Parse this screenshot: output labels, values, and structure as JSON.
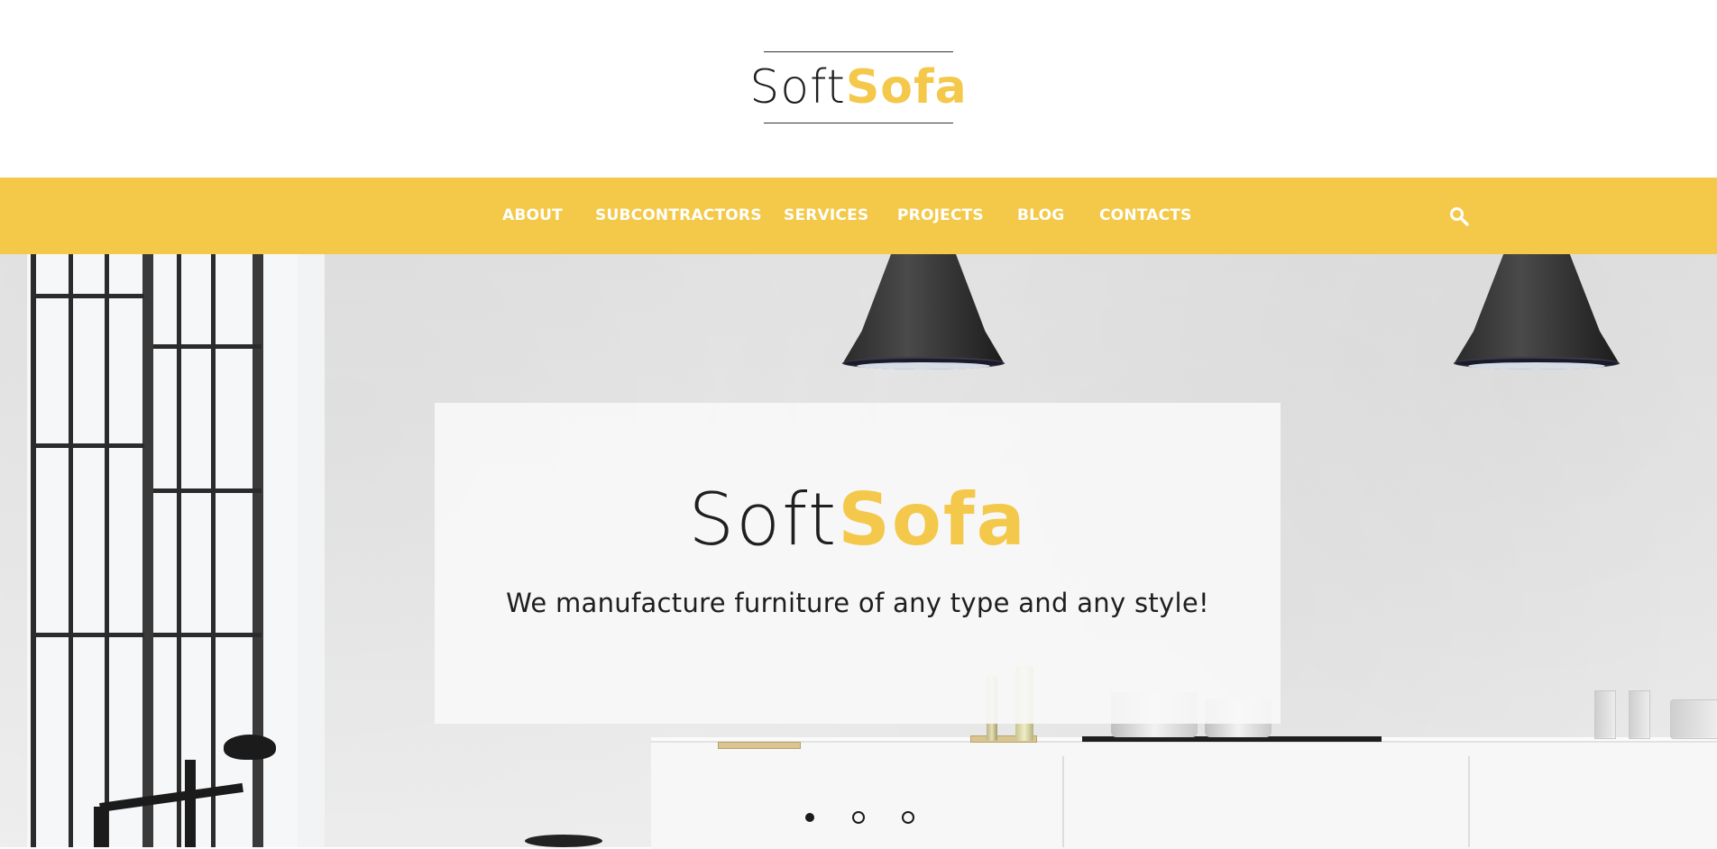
{
  "header": {
    "logo": {
      "part1": "Soft",
      "part2": "Sofa"
    }
  },
  "nav": {
    "items": [
      {
        "label": "ABOUT"
      },
      {
        "label": "SUBCONTRACTORS"
      },
      {
        "label": "SERVICES"
      },
      {
        "label": "PROJECTS"
      },
      {
        "label": "BLOG"
      },
      {
        "label": "CONTACTS"
      }
    ],
    "search_icon": "search-icon"
  },
  "hero": {
    "title_part1": "Soft",
    "title_part2": "Sofa",
    "subtitle": "We manufacture furniture of any type and any style!",
    "slides": {
      "count": 3,
      "active_index": 0
    }
  },
  "colors": {
    "accent": "#f4c94a",
    "text_dark": "#1f1f1f",
    "nav_text": "#ffffff"
  }
}
